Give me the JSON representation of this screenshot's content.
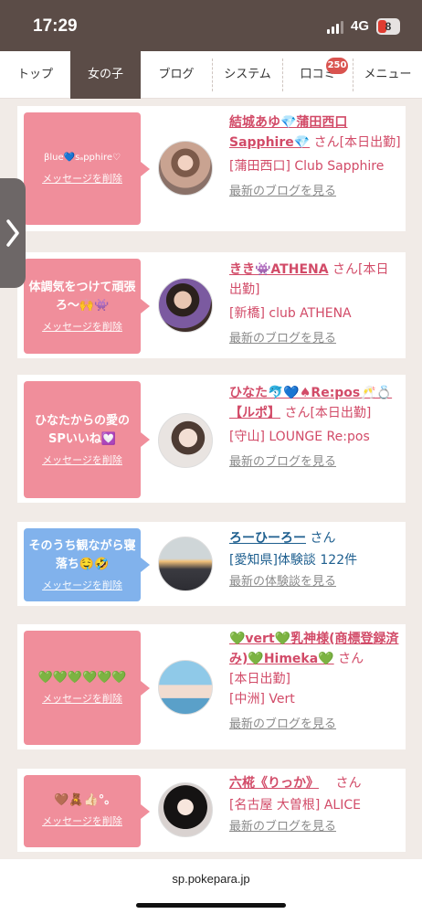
{
  "status": {
    "time": "17:29",
    "network": "4G",
    "battery": "8"
  },
  "nav": {
    "tabs": [
      {
        "label": "トップ"
      },
      {
        "label": "女の子"
      },
      {
        "label": "ブログ"
      },
      {
        "label": "システム"
      },
      {
        "label": "口コミ"
      },
      {
        "label": "メニュー"
      }
    ],
    "active_tab": "女の子",
    "reviews_badge": "250"
  },
  "side_handle": {
    "icon": "chevron-right-icon"
  },
  "messages": [
    {
      "bubble_color": "#f08e9b",
      "message": "βlue💙sₐpphire♡",
      "delete_label": "メッセージを削除",
      "name": "結城あゆ💎蒲田西口Sapphire💎",
      "honorific": "さん",
      "status": "[本日出勤]",
      "shop": "[蒲田西口] Club Sapphire",
      "link": "最新のブログを見る"
    },
    {
      "bubble_color": "#f08e9b",
      "message": "体調気をつけて頑張ろ〜🙌👾",
      "delete_label": "メッセージを削除",
      "name": "きき👾ATHENA",
      "honorific": "さん",
      "status": "[本日出勤]",
      "shop": "[新橋] club ATHENA",
      "link": "最新のブログを見る"
    },
    {
      "bubble_color": "#f08e9b",
      "message": "ひなたからの愛のSPいいね💟",
      "delete_label": "メッセージを削除",
      "name": "ひなた🐬💙♠Re:pos🥂💍【ルポ】",
      "honorific": "さん",
      "status": "[本日出勤]",
      "shop": "[守山] LOUNGE Re:pos",
      "link": "最新のブログを見る"
    },
    {
      "bubble_color": "#81b2ec",
      "message": "そのうち観ながら寝落ち🤤🤣",
      "delete_label": "メッセージを削除",
      "name": "ろーひーろー",
      "honorific": "さん",
      "status": "[愛知県]体験談 122件",
      "shop": "",
      "link": "最新の体験談を見る"
    },
    {
      "bubble_color": "#f08e9b",
      "message": "💚💚💚💚💚💚",
      "delete_label": "メッセージを削除",
      "name": "💚vert💚乳神様(商標登録済み)💚Himeka💚",
      "honorific": "さん",
      "status": "[本日出勤]",
      "shop": "[中洲] Vert",
      "link": "最新のブログを見る"
    },
    {
      "bubble_color": "#f08e9b",
      "message": "🤎🧸👍🏻°｡",
      "delete_label": "メッセージを削除",
      "name": "六椛《りっか》",
      "honorific": "さん",
      "status": "[名古屋 大曽根] ALICE",
      "shop": "",
      "link": "最新のブログを見る"
    }
  ],
  "bottom_bar": {
    "url": "sp.pokepara.jp"
  }
}
